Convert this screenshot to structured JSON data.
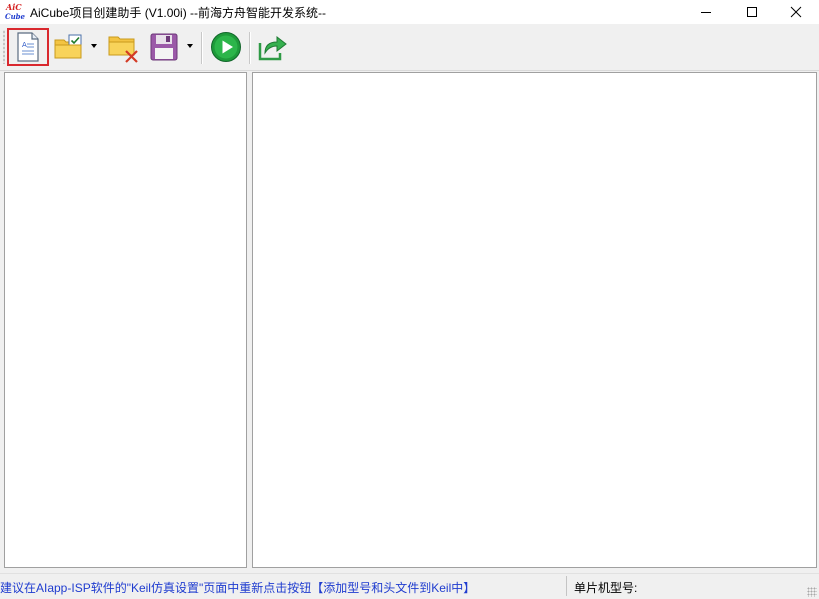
{
  "window": {
    "logo_top": "AiC",
    "logo_bottom": "Cube",
    "title": "AiCube项目创建助手 (V1.00i) --前海方舟智能开发系统--"
  },
  "toolbar": {
    "buttons": [
      {
        "name": "new-project",
        "icon": "new-document-icon",
        "selected": true
      },
      {
        "name": "open-project",
        "icon": "open-folder-check-icon",
        "has_dropdown": true
      },
      {
        "name": "close-project",
        "icon": "folder-delete-icon"
      },
      {
        "name": "save-project",
        "icon": "floppy-disk-icon",
        "has_dropdown": true
      },
      {
        "name": "run",
        "icon": "play-icon"
      },
      {
        "name": "export",
        "icon": "share-arrow-icon"
      }
    ]
  },
  "statusbar": {
    "message": "建议在AIapp-ISP软件的\"Keil仿真设置\"页面中重新点击按钮【添加型号和头文件到Keil中】",
    "chip_label": "单片机型号:",
    "chip_value": ""
  },
  "colors": {
    "status_text": "#1f3ccf",
    "selection_border": "#d9282e",
    "logo_red": "#d42020",
    "logo_blue": "#1f3ccf"
  }
}
